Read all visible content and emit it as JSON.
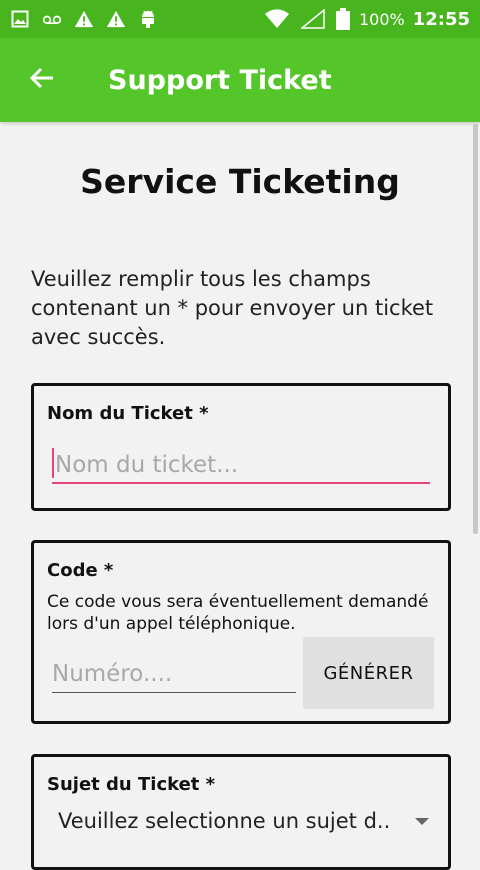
{
  "status_bar": {
    "icons_left": [
      "image-icon",
      "voicemail-icon",
      "warning-icon",
      "warning-icon",
      "android-icon"
    ],
    "battery_percent": "100%",
    "time": "12:55"
  },
  "app_bar": {
    "title": "Support Ticket",
    "background": "#55c62a",
    "status_background": "#48b51e"
  },
  "page": {
    "title": "Service Ticketing",
    "intro": "Veuillez remplir tous les champs contenant un * pour envoyer un ticket avec succès."
  },
  "nom_card": {
    "label": "Nom du Ticket *",
    "placeholder": "Nom du ticket...",
    "value": ""
  },
  "code_card": {
    "label": "Code *",
    "help": "Ce code vous sera éventuellement demandé lors d'un appel téléphonique.",
    "placeholder": "Numéro....",
    "value": "",
    "generate_label": "GÉNÉRER"
  },
  "sujet_card": {
    "label": "Sujet du Ticket *",
    "selected": "Veuillez selectionne un sujet d.."
  },
  "colors": {
    "accent": "#e5457f",
    "text": "#111111"
  }
}
